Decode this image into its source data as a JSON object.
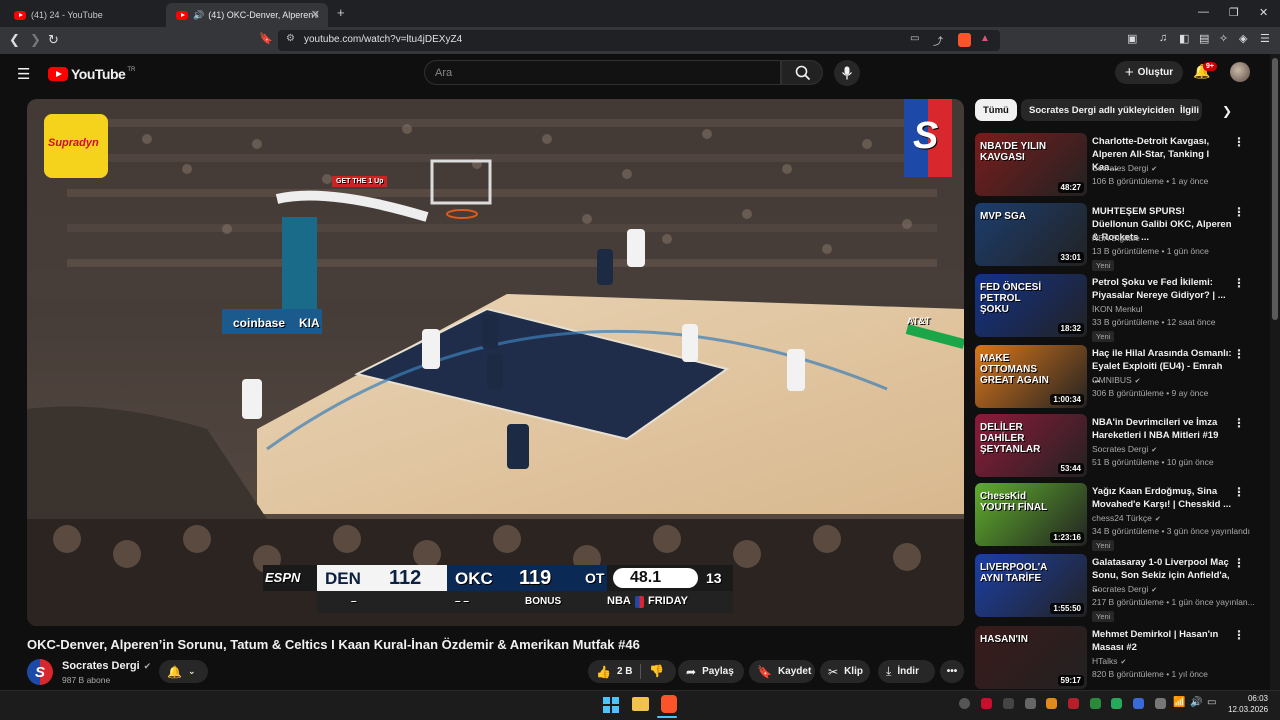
{
  "browser": {
    "tabs": [
      {
        "label": "(41) 24 - YouTube",
        "active": false
      },
      {
        "label": "(41) OKC-Denver, Alperen'in S",
        "active": true
      }
    ],
    "new_tab": "+",
    "url": "youtube.com/watch?v=ltu4jDEXyZ4",
    "window_controls": [
      "—",
      "❐",
      "✕"
    ]
  },
  "header": {
    "logo_text": "YouTube",
    "logo_country": "TR",
    "search_placeholder": "Ara",
    "create_label": "Oluştur",
    "notification_count": "9+"
  },
  "video": {
    "title": "OKC-Denver, Alperen’in Sorunu, Tatum & Celtics I Kaan Kural-İnan Özdemir & Amerikan Mutfak #46",
    "scorebug": {
      "network": "ESPN",
      "team1": "DEN",
      "score1": "112",
      "team2": "OKC",
      "score2": "119",
      "period": "OT",
      "clock": "48.1",
      "shot_clock": "13",
      "fouls1": "–",
      "fouls2": "– –",
      "bonus": "BONUS",
      "league": "NBA",
      "event": "FRIDAY"
    },
    "overlay_sponsor": "Supradyn",
    "overlay_channel_letter": "S",
    "arena_texts": [
      "coinbase",
      "KIA",
      "GET THE 1 Up",
      "AT&T"
    ]
  },
  "channel": {
    "name": "Socrates Dergi",
    "subscribers": "987 B abone"
  },
  "actions": {
    "likes": "2 B",
    "share": "Paylaş",
    "save": "Kaydet",
    "clip": "Klip",
    "download": "İndir"
  },
  "chips": [
    "Tümü",
    "Socrates Dergi adlı yükleyiciden",
    "İlgili"
  ],
  "recommendations": [
    {
      "title": "Charlotte-Detroit Kavgası, Alperen All-Star, Tanking I Kaa...",
      "channel": "Socrates Dergi",
      "verified": true,
      "meta": "106 B görüntüleme • 1 ay önce",
      "duration": "48:27",
      "badge": "",
      "thumb_text": "NBA'DE YILIN KAVGASI",
      "thumb_color": "#7a1c1c"
    },
    {
      "title": "MUHTEŞEM SPURS! Düellonun Galibi OKC, Alperen & Rockets ...",
      "channel": "NBA Digitale",
      "verified": false,
      "meta": "13 B görüntüleme • 1 gün önce",
      "duration": "33:01",
      "badge": "Yeni",
      "thumb_text": "MVP SGA",
      "thumb_color": "#1c3d6e"
    },
    {
      "title": "Petrol Şoku ve Fed İkilemi: Piyasalar Nereye Gidiyor? | ...",
      "channel": "İKON Menkul",
      "verified": false,
      "meta": "33 B görüntüleme • 12 saat önce",
      "duration": "18:32",
      "badge": "Yeni",
      "thumb_text": "FED ÖNCESİ PETROL ŞOKU",
      "thumb_color": "#12328a"
    },
    {
      "title": "Haç ile Hilal Arasında Osmanlı: Eyalet Exploiti (EU4) - Emrah ...",
      "channel": "OMNIBUS",
      "verified": true,
      "meta": "306 B görüntüleme • 9 ay önce",
      "duration": "1:00:34",
      "badge": "",
      "thumb_text": "MAKE OTTOMANS GREAT AGAIN",
      "thumb_color": "#d9761a"
    },
    {
      "title": "NBA'in Devrimcileri ve İmza Hareketleri I NBA Mitleri #19",
      "channel": "Socrates Dergi",
      "verified": true,
      "meta": "51 B görüntüleme • 10 gün önce",
      "duration": "53:44",
      "badge": "",
      "thumb_text": "DELİLER DAHİLER ŞEYTANLAR",
      "thumb_color": "#8e1a3a"
    },
    {
      "title": "Yağız Kaan Erdoğmuş, Sina Movahed'e Karşı! | Chesskid ...",
      "channel": "chess24 Türkçe",
      "verified": true,
      "meta": "34 B görüntüleme • 3 gün önce yayınlandı",
      "duration": "1:23:16",
      "badge": "Yeni",
      "thumb_text": "ChessKid YOUTH FİNAL",
      "thumb_color": "#5fae2c"
    },
    {
      "title": "Galatasaray 1-0 Liverpool Maç Sonu, Son Sekiz için Anfield'a, ...",
      "channel": "Socrates Dergi",
      "verified": true,
      "meta": "217 B görüntüleme • 1 gün önce yayınlan...",
      "duration": "1:55:50",
      "badge": "Yeni",
      "thumb_text": "LIVERPOOL'A AYNI TARİFE",
      "thumb_color": "#1b3fa8"
    },
    {
      "title": "Mehmet Demirkol | Hasan'ın Masası #2",
      "channel": "HTalks",
      "verified": true,
      "meta": "820 B görüntüleme • 1 yıl önce",
      "duration": "59:17",
      "badge": "",
      "thumb_text": "HASAN'IN",
      "thumb_color": "#3a1a1a"
    }
  ],
  "taskbar": {
    "time": "06:03",
    "date": "12.03.2026"
  }
}
